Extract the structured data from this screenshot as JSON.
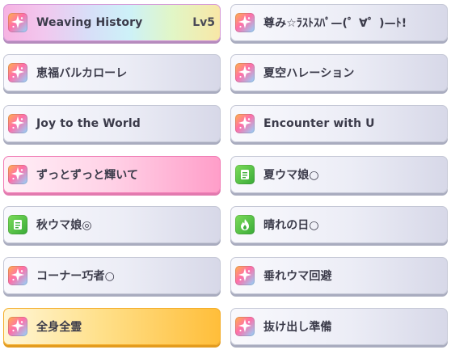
{
  "skills": [
    {
      "name": "Weaving History",
      "level": "Lv5",
      "style": "rainbow",
      "icon": "rainbow-sparkle-icon"
    },
    {
      "name": "尊み☆ﾗｽﾄｽﾊﾟ—(゜∀゜)—ﾄ!",
      "level": "",
      "style": "normal",
      "icon": "rainbow-sparkle-icon"
    },
    {
      "name": "恵福バルカローレ",
      "level": "",
      "style": "normal",
      "icon": "rainbow-sparkle-icon"
    },
    {
      "name": "夏空ハレーション",
      "level": "",
      "style": "normal",
      "icon": "rainbow-sparkle-icon"
    },
    {
      "name": "Joy to the World",
      "level": "",
      "style": "normal",
      "icon": "rainbow-sparkle-icon"
    },
    {
      "name": "Encounter with U",
      "level": "",
      "style": "normal",
      "icon": "rainbow-sparkle-icon"
    },
    {
      "name": "ずっとずっと輝いて",
      "level": "",
      "style": "pink",
      "icon": "rainbow-sparkle-icon"
    },
    {
      "name": "夏ウマ娘○",
      "level": "",
      "style": "normal",
      "icon": "green-document-icon"
    },
    {
      "name": "秋ウマ娘◎",
      "level": "",
      "style": "normal",
      "icon": "green-document-icon"
    },
    {
      "name": "晴れの日○",
      "level": "",
      "style": "normal",
      "icon": "green-flame-icon"
    },
    {
      "name": "コーナー巧者○",
      "level": "",
      "style": "normal",
      "icon": "rainbow-sparkle-icon"
    },
    {
      "name": "垂れウマ回避",
      "level": "",
      "style": "normal",
      "icon": "rainbow-sparkle-icon"
    },
    {
      "name": "全身全霊",
      "level": "",
      "style": "gold",
      "icon": "rainbow-sparkle-icon"
    },
    {
      "name": "抜け出し準備",
      "level": "",
      "style": "normal",
      "icon": "rainbow-sparkle-icon"
    }
  ]
}
